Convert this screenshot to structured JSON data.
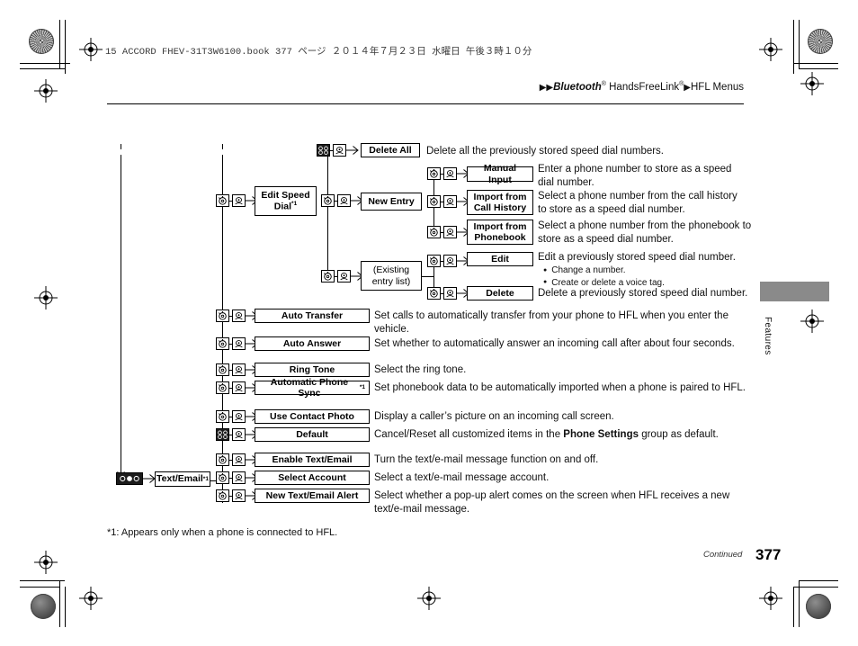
{
  "header": {
    "book_line": "15 ACCORD FHEV-31T3W6100.book   377 ページ   ２０１４年７月２３日   水曜日   午後３時１０分",
    "breadcrumb_arrow1": "▶▶",
    "breadcrumb_bluetooth": "Bluetooth",
    "breadcrumb_reg1": "®",
    "breadcrumb_hfl": " HandsFreeLink",
    "breadcrumb_reg2": "®",
    "breadcrumb_arrow2": "▶",
    "breadcrumb_menus": "HFL Menus"
  },
  "side_tab": {
    "label": "Features"
  },
  "footer": {
    "footnote": "*1: Appears only when a phone is connected to HFL.",
    "continued": "Continued",
    "page_number": "377"
  },
  "diagram": {
    "nodes": {
      "delete_all": "Delete All",
      "edit_speed_dial": "Edit Speed Dial",
      "edit_speed_dial_sup": "*1",
      "new_entry": "New Entry",
      "manual_input": "Manual Input",
      "import_call_history_l1": "Import from",
      "import_call_history_l2": "Call History",
      "import_phonebook_l1": "Import from",
      "import_phonebook_l2": "Phonebook",
      "existing_entry_l1": "(Existing",
      "existing_entry_l2": "entry list)",
      "edit": "Edit",
      "delete": "Delete",
      "auto_transfer": "Auto Transfer",
      "auto_answer": "Auto Answer",
      "ring_tone": "Ring Tone",
      "automatic_phone_sync": "Automatic Phone Sync",
      "automatic_phone_sync_sup": "*1",
      "use_contact_photo": "Use Contact Photo",
      "default": "Default",
      "text_email": "Text/Email",
      "text_email_sup": "*1",
      "enable_text_email": "Enable Text/Email",
      "select_account": "Select Account",
      "new_text_email_alert": "New Text/Email Alert"
    },
    "descriptions": {
      "delete_all": "Delete all the previously stored speed dial numbers.",
      "manual_input": "Enter a phone number to store as a speed dial number.",
      "import_call_history": "Select a phone number from the call history to store as a speed dial number.",
      "import_phonebook": "Select a phone number from the phonebook to store as a speed dial number.",
      "edit": "Edit a previously stored speed dial number.",
      "edit_bullet_1": "Change a number.",
      "edit_bullet_2": "Create or delete a voice tag.",
      "delete": "Delete a previously stored speed dial number.",
      "auto_transfer": "Set calls to automatically transfer from your phone to HFL when you enter the vehicle.",
      "auto_answer": "Set whether to automatically answer an incoming call after about four seconds.",
      "ring_tone": "Select the ring tone.",
      "automatic_phone_sync": "Set phonebook data to be automatically imported when a phone is paired to HFL.",
      "use_contact_photo": "Display a caller’s picture on an incoming call screen.",
      "default_pre": "Cancel/Reset all customized items in the ",
      "default_bold": "Phone Settings",
      "default_post": " group as default.",
      "enable_text_email": "Turn the text/e-mail message function on and off.",
      "select_account": "Select a text/e-mail message account.",
      "new_text_email_alert": "Select whether a pop-up alert comes on the screen when HFL receives a new text/e-mail message."
    },
    "icons": {
      "dial_knob": "rotary-dial-icon",
      "press_knob": "press-knob-icon",
      "multi_button": "multi-button-icon",
      "arrow": "arrow-right-icon"
    }
  },
  "colors": {
    "tab_gray": "#8a8a8a",
    "ink": "#111111",
    "paper": "#ffffff"
  }
}
